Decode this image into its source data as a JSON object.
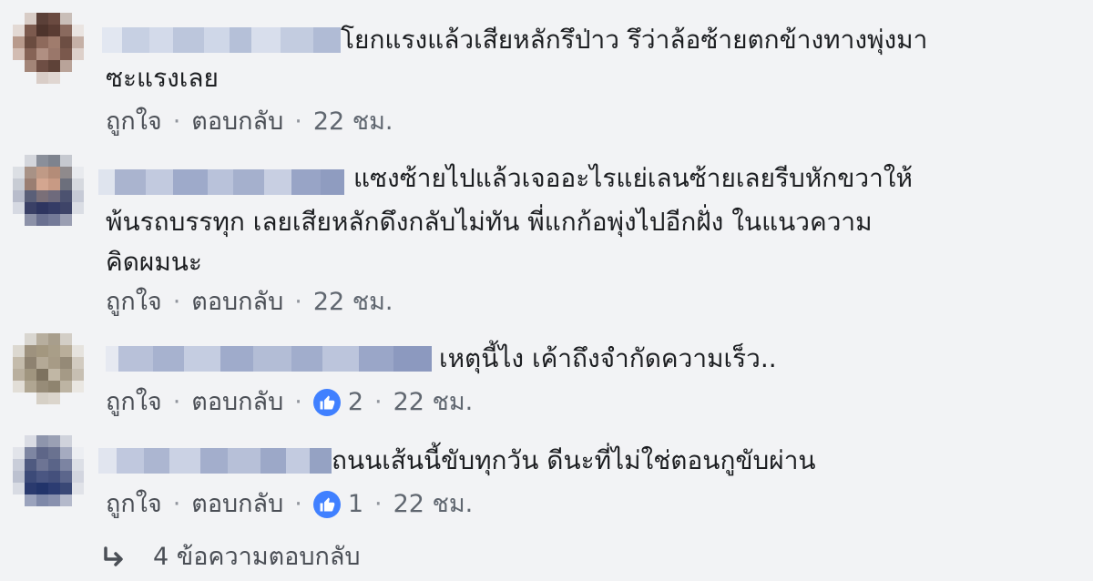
{
  "comments": [
    {
      "line1": "โยกแรงแล้วเสียหลักรึป่าว รึว่าล้อซ้ายตกข้างทางพุ่งมา",
      "line2": "ซะแรงเลย",
      "line3": "",
      "like_label": "ถูกใจ",
      "reply_label": "ตอบกลับ",
      "separator": "·",
      "reaction_count": "",
      "time": "22 ชม."
    },
    {
      "line1": "แซงซ้ายไปแล้วเจออะไรแย่เลนซ้ายเลยรีบหักขวาให้",
      "line2": "พ้นรถบรรทุก เลยเสียหลักดึงกลับไม่ทัน พี่แกก้อพุ่งไปอีกฝั่ง ในแนวความ",
      "line3": "คิดผมนะ",
      "like_label": "ถูกใจ",
      "reply_label": "ตอบกลับ",
      "separator": "·",
      "reaction_count": "",
      "time": "22 ชม."
    },
    {
      "line1": "เหตุนี้ไง เค้าถึงจำกัดความเร็ว..",
      "line2": "",
      "line3": "",
      "like_label": "ถูกใจ",
      "reply_label": "ตอบกลับ",
      "separator": "·",
      "reaction_count": "2",
      "time": "22 ชม."
    },
    {
      "line1": "ถนนเส้นนี้ขับทุกวัน ดีนะที่ไม่ใช่ตอนกูขับผ่าน",
      "line2": "",
      "line3": "",
      "like_label": "ถูกใจ",
      "reply_label": "ตอบกลับ",
      "separator": "·",
      "reaction_count": "1",
      "time": "22 ชม."
    }
  ],
  "replies_link": {
    "label": "4 ข้อความตอบกลับ",
    "icon": "reply-arrow-icon"
  },
  "colors": {
    "background": "#f2f3f5",
    "text": "#1c1e21",
    "meta": "#606770",
    "like_badge": "#4080ff",
    "arrow": "#4b4f56"
  }
}
